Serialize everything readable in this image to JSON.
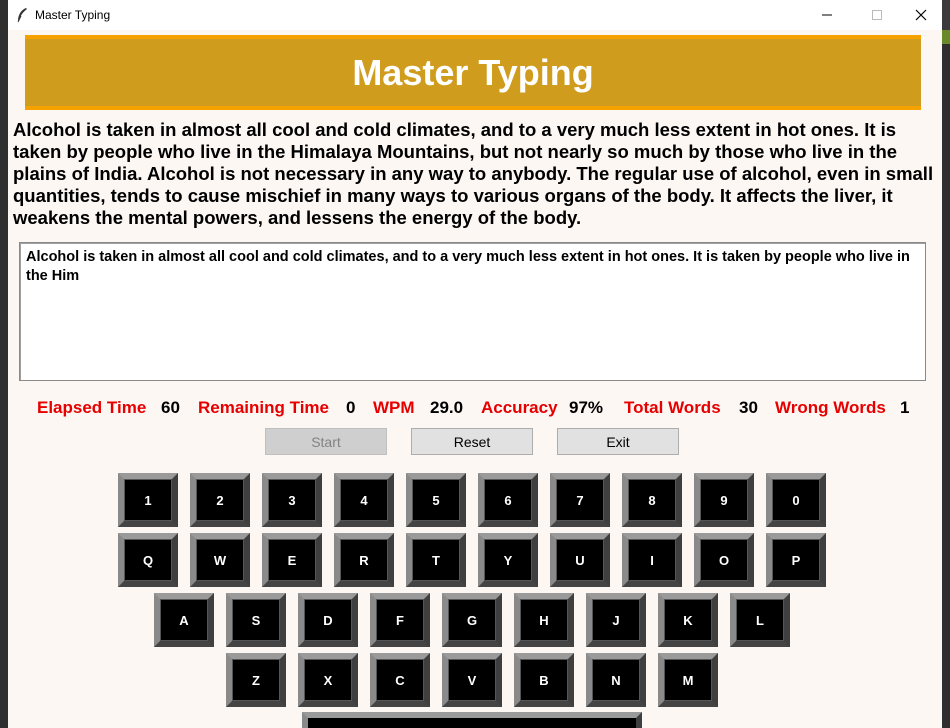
{
  "window": {
    "title": "Master Typing",
    "icon": "feather-icon"
  },
  "banner": {
    "title": "Master Typing"
  },
  "passage": "Alcohol is taken in almost all cool and cold climates, and to a very much less extent in hot ones. It is taken by people who live in the Himalaya Mountains, but not nearly so much by those who live in the plains of India. Alcohol is not necessary in any way to anybody. The regular use of alcohol, even in small quantities, tends to cause mischief in many ways to various organs of the body. It affects the liver, it weakens the mental powers, and lessens the energy of the body.",
  "typing_box": {
    "value": "Alcohol is taken in almost all cool and cold climates, and to a very much less extent in hot ones. It is taken by people who live in the Him"
  },
  "stats": {
    "elapsed_label": "Elapsed Time",
    "elapsed_value": "60",
    "remaining_label": "Remaining Time",
    "remaining_value": "0",
    "wpm_label": "WPM",
    "wpm_value": "29.0",
    "accuracy_label": "Accuracy",
    "accuracy_value": "97%",
    "total_label": "Total Words",
    "total_value": "30",
    "wrong_label": "Wrong Words",
    "wrong_value": "1"
  },
  "buttons": {
    "start": "Start",
    "reset": "Reset",
    "exit": "Exit"
  },
  "keyboard": {
    "row1": [
      "1",
      "2",
      "3",
      "4",
      "5",
      "6",
      "7",
      "8",
      "9",
      "0"
    ],
    "row2": [
      "Q",
      "W",
      "E",
      "R",
      "T",
      "Y",
      "U",
      "I",
      "O",
      "P"
    ],
    "row3": [
      "A",
      "S",
      "D",
      "F",
      "G",
      "H",
      "J",
      "K",
      "L"
    ],
    "row4": [
      "Z",
      "X",
      "C",
      "V",
      "B",
      "N",
      "M"
    ]
  },
  "colors": {
    "banner_bg": "#d09c1e",
    "banner_border": "#f5a200",
    "stat_label": "#e60000"
  }
}
